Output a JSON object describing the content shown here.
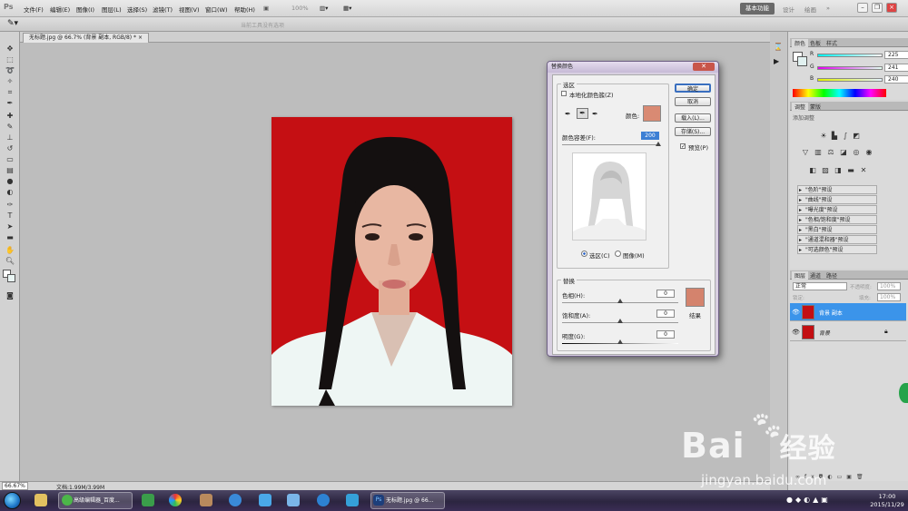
{
  "menubar": {
    "items": [
      "文件(F)",
      "编辑(E)",
      "图像(I)",
      "图层(L)",
      "选择(S)",
      "滤镜(T)",
      "视图(V)",
      "窗口(W)",
      "帮助(H)"
    ],
    "zoom": "100%",
    "workspace": "基本功能",
    "links": [
      "设计",
      "绘画"
    ],
    "more": "»"
  },
  "optbar": {
    "hint": "当前工具没有选项"
  },
  "doc": {
    "tab": "无标题.jpg @ 66.7% (背景 副本, RGB/8) *",
    "tab_close": "×"
  },
  "status": {
    "zoom": "66.67%",
    "doc": "文档:1.99M/3.99M"
  },
  "color_panel": {
    "tabs": [
      "颜色",
      "色板",
      "样式"
    ],
    "r": "225",
    "g": "241",
    "b": "240",
    "labels": [
      "R",
      "G",
      "B"
    ]
  },
  "adjust_panel": {
    "tabs": [
      "调整",
      "蒙版"
    ],
    "subtitle": "添加调整",
    "presets": [
      "\"色阶\"预设",
      "\"曲线\"预设",
      "\"曝光度\"预设",
      "\"色相/饱和度\"预设",
      "\"黑白\"预设",
      "\"通道混和器\"预设",
      "\"可选颜色\"预设"
    ]
  },
  "layers_panel": {
    "tabs": [
      "图层",
      "通道",
      "路径"
    ],
    "mode": "正常",
    "opacity_label": "不透明度:",
    "opacity": "100%",
    "lock_label": "锁定:",
    "fill_label": "填充:",
    "fill": "100%",
    "layers": [
      {
        "name": "背景 副本",
        "selected": true
      },
      {
        "name": "背景",
        "selected": false
      }
    ]
  },
  "dialog": {
    "title": "替换颜色",
    "close": "✕",
    "selection_group": "选区",
    "localized": "本地化颜色簇(Z)",
    "color_label": "颜色:",
    "tolerance_label": "颜色容差(F):",
    "tolerance": "200",
    "radio_selection": "选区(C)",
    "radio_image": "图像(M)",
    "replace_group": "替换",
    "hue_label": "色相(H):",
    "hue": "0",
    "sat_label": "饱和度(A):",
    "sat": "0",
    "light_label": "明度(G):",
    "light": "0",
    "result_label": "结果",
    "ok": "确定",
    "cancel": "取消",
    "load": "载入(L)...",
    "save": "存储(S)...",
    "preview": "预览(P)",
    "swatch_color": "#d98a73",
    "result_color": "#d4836d"
  },
  "taskbar": {
    "items": [
      "高级编辑器_百度...",
      "无标题.jpg @ 66..."
    ],
    "time": "17:00",
    "date": "2015/11/29"
  },
  "watermark": {
    "brand": "Bai",
    "brand2": "经验",
    "url": "jingyan.baidu.com"
  }
}
